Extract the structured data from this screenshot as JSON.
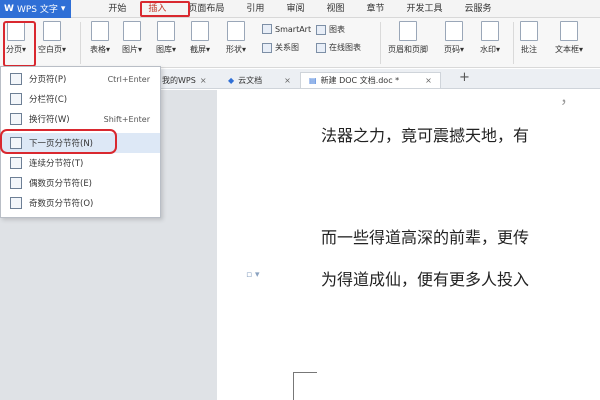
{
  "app": {
    "name": "WPS 文字",
    "logo": "W",
    "dropdown_glyph": "▾"
  },
  "menu_tabs": [
    "开始",
    "插入",
    "页面布局",
    "引用",
    "审阅",
    "视图",
    "章节",
    "开发工具",
    "云服务"
  ],
  "active_menu_tab": "插入",
  "ribbon": {
    "fenye": "分页",
    "kongbaiye": "空白页",
    "biaoge": "表格",
    "tupian": "图片",
    "tuku": "图库",
    "jieping": "截屏",
    "xingzhuang": "形状",
    "smartart": "SmartArt",
    "tubiao": "图表",
    "guanxitu": "关系图",
    "zaixian_tubiao": "在线图表",
    "yemei_yejiao": "页眉和页脚",
    "yema": "页码",
    "shuiyin": "水印",
    "pizhu": "批注",
    "wenbenkuang": "文本框"
  },
  "doc_tabs": {
    "mywps": "我的WPS",
    "yunwendang": "云文档",
    "active_doc": "新建 DOC 文档.doc *",
    "close_glyph": "×",
    "new_tab_glyph": "+"
  },
  "document": {
    "top_partial": "，",
    "line1": "法器之力，竟可震撼天地，有",
    "line2": "而一些得道高深的前辈，更传",
    "line3": "为得道成仙，便有更多人投入"
  },
  "paragraph_marker": "▫ ▾",
  "dropdown_menu": [
    {
      "label": "分页符(P)",
      "shortcut": "Ctrl+Enter"
    },
    {
      "label": "分栏符(C)",
      "shortcut": ""
    },
    {
      "label": "换行符(W)",
      "shortcut": "Shift+Enter"
    },
    {
      "label": "下一页分节符(N)",
      "shortcut": ""
    },
    {
      "label": "连续分节符(T)",
      "shortcut": ""
    },
    {
      "label": "偶数页分节符(E)",
      "shortcut": ""
    },
    {
      "label": "奇数页分节符(O)",
      "shortcut": ""
    }
  ],
  "colors": {
    "accent": "#2f6fd6",
    "highlight_red": "#d9282f",
    "hover_blue": "#dde8f6"
  }
}
